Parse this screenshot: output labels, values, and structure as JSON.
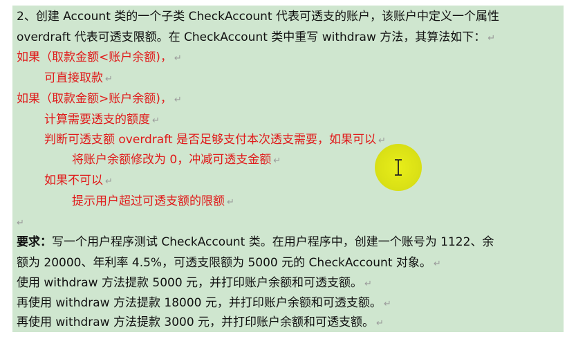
{
  "lines": [
    {
      "text": "2、创建 Account 类的一个子类 CheckAccount 代表可透支的账户，该账户中定义一个属性",
      "mark": "",
      "color": "black"
    },
    {
      "text": "overdraft 代表可透支限额。在 CheckAccount 类中重写 withdraw 方法，其算法如下：",
      "mark": "↵",
      "color": "black"
    },
    {
      "text": "如果（取款金额<账户余额)，",
      "mark": "↵",
      "color": "red"
    },
    {
      "text": "可直接取款",
      "mark": "↵",
      "color": "red"
    },
    {
      "text": "如果（取款金额>账户余额)，",
      "mark": "↵",
      "color": "red"
    },
    {
      "text": "计算需要透支的额度",
      "mark": "↵",
      "color": "red"
    },
    {
      "text": "判断可透支额 overdraft 是否足够支付本次透支需要，如果可以",
      "mark": "↵",
      "color": "red"
    },
    {
      "text": "将账户余额修改为 0，冲减可透支金额",
      "mark": "↵",
      "color": "red"
    },
    {
      "text": "如果不可以",
      "mark": "↵",
      "color": "red"
    },
    {
      "text": "提示用户超过可透支额的限额",
      "mark": "↵",
      "color": "red"
    },
    {
      "text": "",
      "mark": "↵",
      "color": "black"
    },
    {
      "label": "要求：",
      "text": "写一个用户程序测试 CheckAccount 类。在用户程序中，创建一个账号为 1122、余",
      "mark": "",
      "color": "black"
    },
    {
      "text": "额为 20000、年利率 4.5%，可透支限额为 5000 元的 CheckAccount 对象。",
      "mark": "↵",
      "color": "black"
    },
    {
      "text": "使用 withdraw 方法提款 5000 元，并打印账户余额和可透支额。",
      "mark": "↵",
      "color": "black"
    },
    {
      "text": "再使用 withdraw 方法提款 18000 元，并打印账户余额和可透支额。",
      "mark": "↵",
      "color": "black"
    },
    {
      "text": "再使用 withdraw 方法提款 3000 元，并打印账户余额和可透支额。",
      "mark": "↵",
      "color": "black"
    }
  ],
  "colors": {
    "background": "#cfe6cf",
    "text": "#111111",
    "red": "#e01a1a",
    "highlight": "#e4e80e"
  },
  "cursor": {
    "icon": "text-cursor-icon"
  }
}
